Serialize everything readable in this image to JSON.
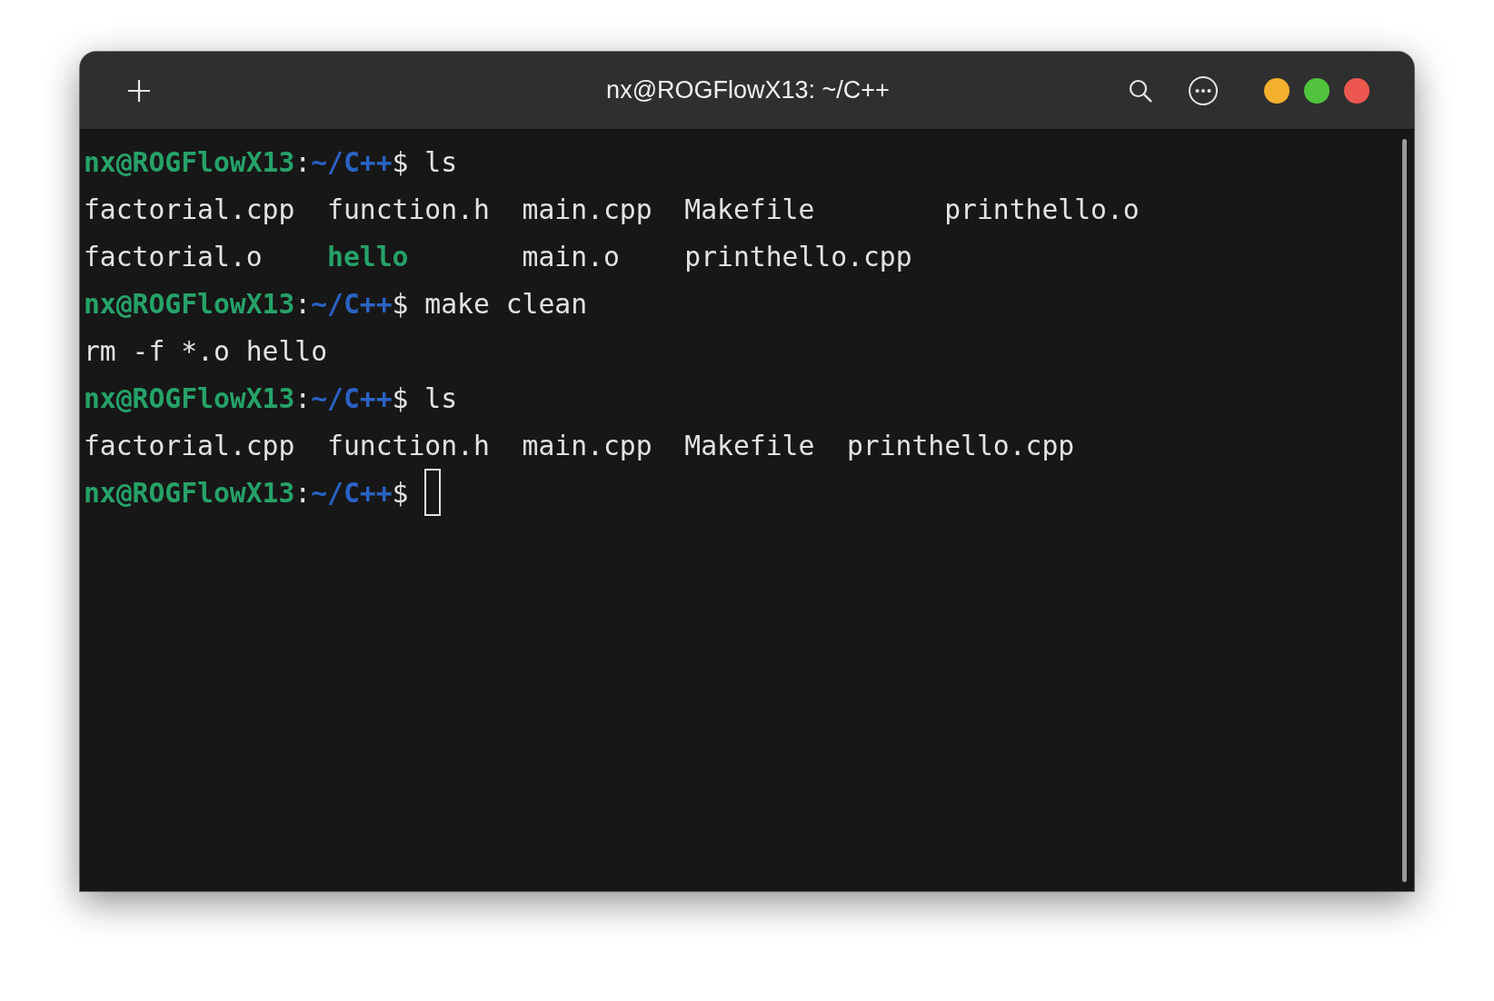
{
  "window": {
    "title": "nx@ROGFlowX13: ~/C++"
  },
  "terminal": {
    "lines": [
      {
        "kind": "prompt",
        "user": "nx@ROGFlowX13",
        "separator": ":",
        "path": "~/C++",
        "symbol": "$",
        "command": "ls",
        "cursor": false
      },
      {
        "kind": "listing",
        "rows": [
          [
            {
              "name": "factorial.cpp",
              "executable": false
            },
            {
              "name": "function.h",
              "executable": false
            },
            {
              "name": "main.cpp",
              "executable": false
            },
            {
              "name": "Makefile",
              "executable": false
            },
            {
              "name": "printhello.o",
              "executable": false
            }
          ],
          [
            {
              "name": "factorial.o",
              "executable": false
            },
            {
              "name": "hello",
              "executable": true
            },
            {
              "name": "main.o",
              "executable": false
            },
            {
              "name": "printhello.cpp",
              "executable": false
            }
          ]
        ]
      },
      {
        "kind": "prompt",
        "user": "nx@ROGFlowX13",
        "separator": ":",
        "path": "~/C++",
        "symbol": "$",
        "command": "make clean",
        "cursor": false
      },
      {
        "kind": "output",
        "text": "rm -f *.o hello"
      },
      {
        "kind": "prompt",
        "user": "nx@ROGFlowX13",
        "separator": ":",
        "path": "~/C++",
        "symbol": "$",
        "command": "ls",
        "cursor": false
      },
      {
        "kind": "listing",
        "rows": [
          [
            {
              "name": "factorial.cpp",
              "executable": false
            },
            {
              "name": "function.h",
              "executable": false
            },
            {
              "name": "main.cpp",
              "executable": false
            },
            {
              "name": "Makefile",
              "executable": false
            },
            {
              "name": "printhello.cpp",
              "executable": false
            }
          ]
        ]
      },
      {
        "kind": "prompt",
        "user": "nx@ROGFlowX13",
        "separator": ":",
        "path": "~/C++",
        "symbol": "$",
        "cursor": true
      }
    ]
  }
}
